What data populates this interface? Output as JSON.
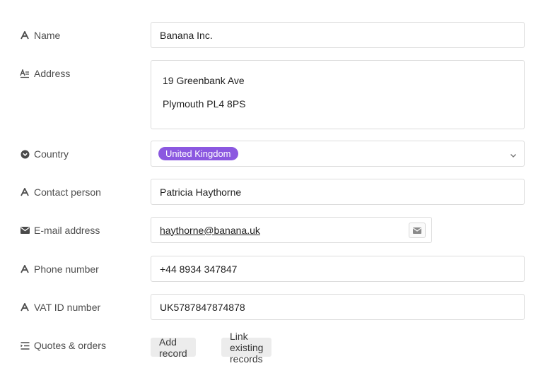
{
  "fields": {
    "name": {
      "label": "Name",
      "value": "Banana Inc.",
      "icon": "text-a-icon"
    },
    "address": {
      "label": "Address",
      "line1": "19 Greenbank Ave",
      "line2": "Plymouth PL4 8PS",
      "icon": "long-text-icon"
    },
    "country": {
      "label": "Country",
      "value": "United Kingdom",
      "icon": "select-chevron-icon"
    },
    "contact": {
      "label": "Contact person",
      "value": "Patricia Haythorne",
      "icon": "text-a-icon"
    },
    "email": {
      "label": "E-mail address",
      "value": "haythorne@banana.uk",
      "icon": "envelope-icon"
    },
    "phone": {
      "label": "Phone number",
      "value": "+44 8934 347847",
      "icon": "text-a-icon"
    },
    "vat": {
      "label": "VAT ID number",
      "value": "UK5787847874878",
      "icon": "text-a-icon"
    },
    "quotes": {
      "label": "Quotes & orders",
      "icon": "linked-records-icon"
    }
  },
  "buttons": {
    "add_record": "Add record",
    "link_existing": "Link existing records"
  },
  "colors": {
    "tag_purple": "#8b58e0",
    "border": "#dcdcdc",
    "button_bg": "#ececec"
  }
}
